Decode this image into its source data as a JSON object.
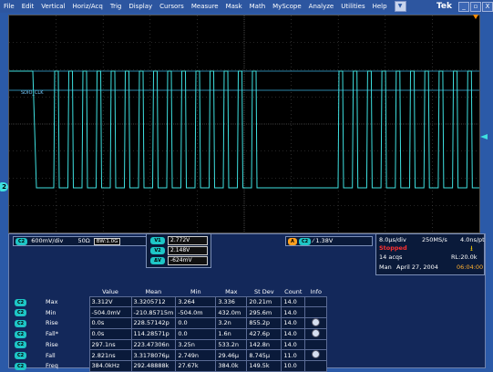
{
  "menu": {
    "items": [
      "File",
      "Edit",
      "Vertical",
      "Horiz/Acq",
      "Trig",
      "Display",
      "Cursors",
      "Measure",
      "Mask",
      "Math",
      "MyScope",
      "Analyze",
      "Utilities",
      "Help"
    ],
    "brand": "Tek"
  },
  "window_buttons": [
    "_",
    "▫",
    "X"
  ],
  "scope": {
    "channel_label": "SDIO_CLK",
    "channel_marker": "2"
  },
  "channel_info": {
    "chip": "C2",
    "volts_div": "600mV/div",
    "impedance": "50Ω",
    "bw": "1.0G",
    "bw_prefix": "BW:"
  },
  "cursors": [
    {
      "chip": "V1",
      "value": "2.772V"
    },
    {
      "chip": "V2",
      "value": "2.148V"
    },
    {
      "chip": "ΔV",
      "value": "-624mV"
    }
  ],
  "trigger": {
    "chip_a": "A",
    "chip_ch": "C2",
    "slope": "⁄",
    "level": "1.38V"
  },
  "acquisition": {
    "time_div": "8.0μs/div",
    "sample_rate": "250MS/s",
    "ns_pt": "4.0ns/pt",
    "status": "Stopped",
    "acqs": "14 acqs",
    "record_length": "RL:20.0k",
    "mode": "Man",
    "date": "April 27, 2004",
    "time": "06:04:00"
  },
  "measurements": {
    "headers": [
      "",
      "",
      "Value",
      "Mean",
      "Min",
      "Max",
      "St Dev",
      "Count",
      "Info"
    ],
    "rows": [
      {
        "src": "C2",
        "label": "Max",
        "value": "3.312V",
        "mean": "3.3205712",
        "min": "3.264",
        "max": "3.336",
        "stdev": "20.21m",
        "count": "14.0",
        "info": false
      },
      {
        "src": "C2",
        "label": "Min",
        "value": "-504.0mV",
        "mean": "-210.85715m",
        "min": "-504.0m",
        "max": "432.0m",
        "stdev": "295.6m",
        "count": "14.0",
        "info": false
      },
      {
        "src": "C2",
        "label": "Rise",
        "value": "0.0s",
        "mean": "228.57142p",
        "min": "0.0",
        "max": "3.2n",
        "stdev": "855.2p",
        "count": "14.0",
        "info": true
      },
      {
        "src": "C2",
        "label": "Fall*",
        "value": "0.0s",
        "mean": "114.28571p",
        "min": "0.0",
        "max": "1.6n",
        "stdev": "427.6p",
        "count": "14.0",
        "info": true
      },
      {
        "src": "C2",
        "label": "Rise",
        "value": "297.1ns",
        "mean": "223.47306n",
        "min": "3.25n",
        "max": "533.2n",
        "stdev": "142.8n",
        "count": "14.0",
        "info": false
      },
      {
        "src": "C2",
        "label": "Fall",
        "value": "2.821ns",
        "mean": "3.3178076μ",
        "min": "2.749n",
        "max": "29.46μ",
        "stdev": "8.745μ",
        "count": "11.0",
        "info": true
      },
      {
        "src": "C2",
        "label": "Freq",
        "value": "384.0kHz",
        "mean": "292.48888k",
        "min": "27.67k",
        "max": "384.0k",
        "stdev": "149.5k",
        "count": "10.0",
        "info": false
      }
    ]
  },
  "colors": {
    "trace": "#3ee0e0",
    "grid": "#4a4a4a",
    "background": "#000000"
  }
}
